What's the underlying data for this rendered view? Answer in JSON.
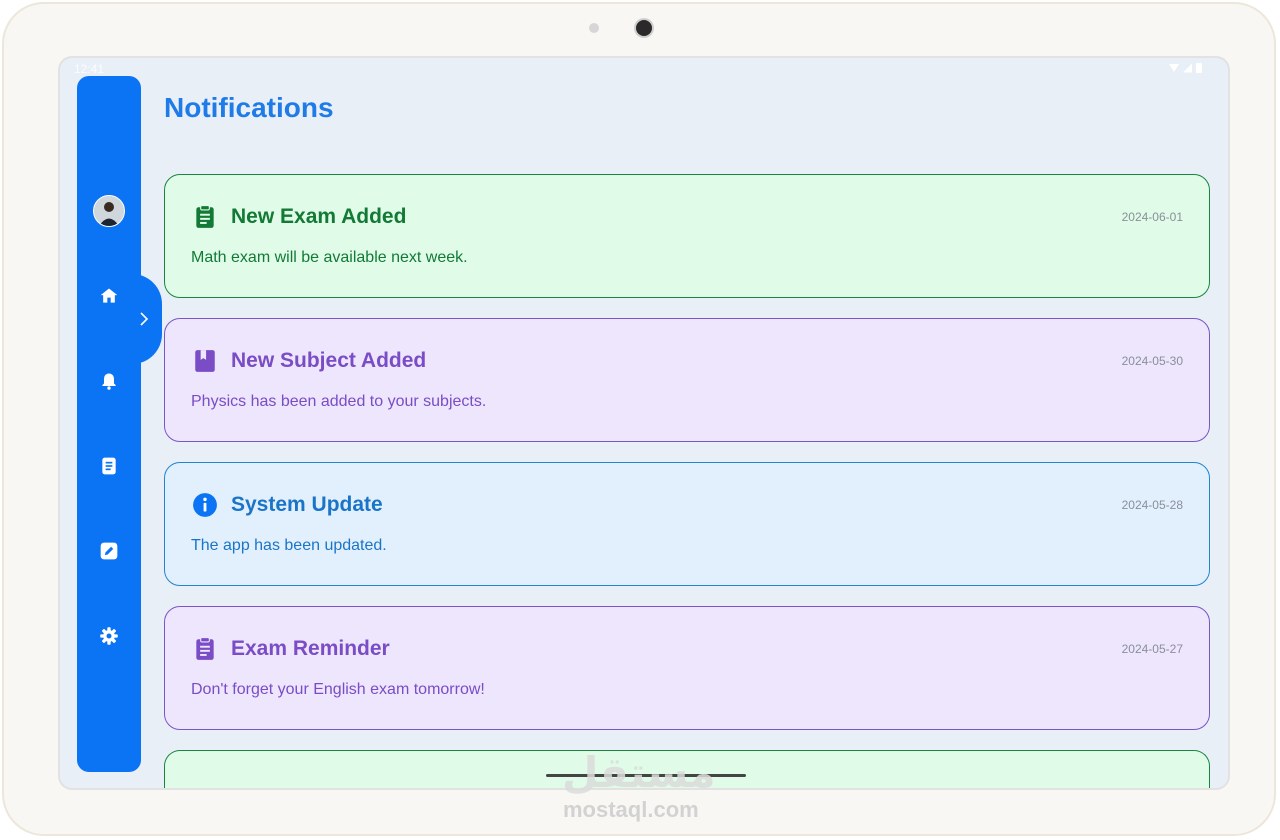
{
  "status_bar": {
    "time": "12:41"
  },
  "page": {
    "title": "Notifications"
  },
  "sidebar": {
    "items": [
      {
        "name": "home",
        "icon": "home-icon"
      },
      {
        "name": "notifications",
        "icon": "bell-icon"
      },
      {
        "name": "documents",
        "icon": "document-icon"
      },
      {
        "name": "edit",
        "icon": "edit-icon"
      },
      {
        "name": "settings",
        "icon": "gear-icon"
      }
    ],
    "toggle_icon": "chevron-right-icon"
  },
  "notifications": [
    {
      "title": "New Exam Added",
      "date": "2024-06-01",
      "message": "Math exam will be available next week.",
      "icon": "clipboard-icon",
      "color": "#127a35"
    },
    {
      "title": "New Subject Added",
      "date": "2024-05-30",
      "message": "Physics has been added to your subjects.",
      "icon": "book-icon",
      "color": "#7a4cc6"
    },
    {
      "title": "System Update",
      "date": "2024-05-28",
      "message": "The app has been updated.",
      "icon": "info-icon",
      "color": "#1a75c9"
    },
    {
      "title": "Exam Reminder",
      "date": "2024-05-27",
      "message": "Don't forget your English exam tomorrow!",
      "icon": "clipboard-icon",
      "color": "#7a4cc6"
    }
  ],
  "colors": {
    "accent": "#0a74f5",
    "title": "#1e7be8",
    "screen_bg": "#e8eff7"
  },
  "watermark": {
    "arabic": "مستقل",
    "latin": "mostaql.com"
  }
}
